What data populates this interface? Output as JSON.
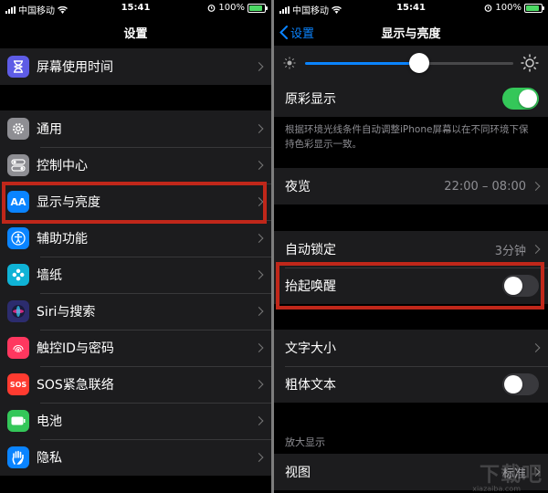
{
  "status_bar": {
    "carrier": "中国移动",
    "time": "15:41",
    "battery": "100%"
  },
  "left": {
    "title": "设置",
    "items": [
      {
        "label": "屏幕使用时间",
        "icon": "hourglass-icon",
        "color": "#5e5ce6"
      },
      {
        "label": "通用",
        "icon": "gear-icon",
        "color": "#8e8e93"
      },
      {
        "label": "控制中心",
        "icon": "toggles-icon",
        "color": "#8e8e93"
      },
      {
        "label": "显示与亮度",
        "icon": "text-size-icon",
        "color": "#0a84ff"
      },
      {
        "label": "辅助功能",
        "icon": "accessibility-icon",
        "color": "#0a84ff"
      },
      {
        "label": "墙纸",
        "icon": "flower-icon",
        "color": "#0fb3d6"
      },
      {
        "label": "Siri与搜索",
        "icon": "siri-icon",
        "color": "#2c2c6e"
      },
      {
        "label": "触控ID与密码",
        "icon": "fingerprint-icon",
        "color": "#ff375f"
      },
      {
        "label": "SOS紧急联络",
        "icon": "sos-icon",
        "color": "#ff3b30"
      },
      {
        "label": "电池",
        "icon": "battery-icon",
        "color": "#34c759"
      },
      {
        "label": "隐私",
        "icon": "hand-icon",
        "color": "#0a84ff"
      }
    ],
    "aa_glyph": "AA",
    "sos_glyph": "SOS"
  },
  "right": {
    "back_label": "设置",
    "title": "显示与亮度",
    "brightness": 0.55,
    "true_tone": {
      "label": "原彩显示",
      "on": true
    },
    "true_tone_note": "根据环境光线条件自动调整iPhone屏幕以在不同环境下保持色彩显示一致。",
    "night_shift": {
      "label": "夜览",
      "value": "22:00 – 08:00"
    },
    "auto_lock": {
      "label": "自动锁定",
      "value": "3分钟"
    },
    "raise_to_wake": {
      "label": "抬起唤醒",
      "on": false
    },
    "text_size": {
      "label": "文字大小"
    },
    "bold_text": {
      "label": "粗体文本",
      "on": false
    },
    "zoom_header": "放大显示",
    "view": {
      "label": "视图",
      "value": "标准"
    }
  },
  "watermark": {
    "text": "下载吧",
    "sub": "xiazaiba.com"
  },
  "colors": {
    "highlight": "#c0271a",
    "accent": "#0a84ff",
    "toggle_on": "#34c759"
  }
}
